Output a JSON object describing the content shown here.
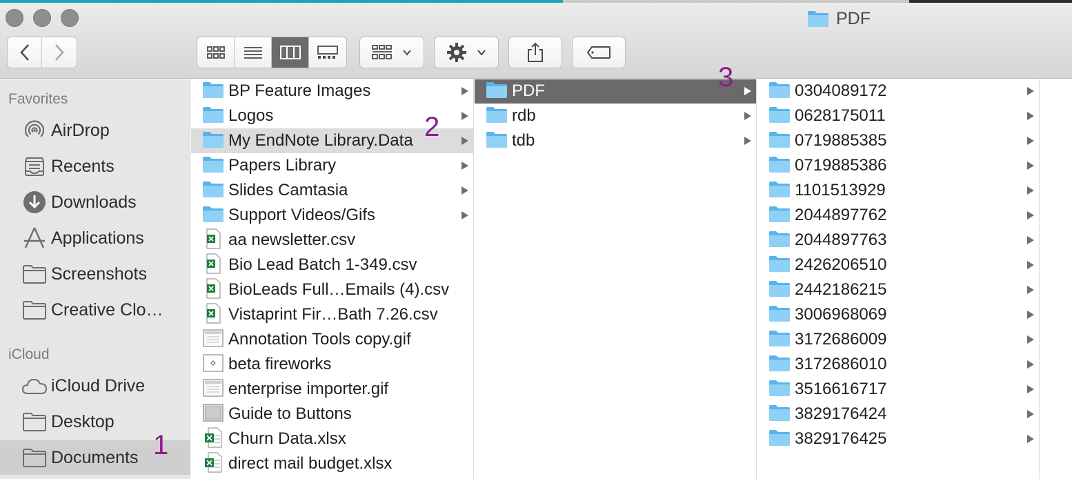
{
  "window": {
    "title": "PDF"
  },
  "toolbar": {
    "back_label": "Back",
    "forward_label": "Forward"
  },
  "sidebar": {
    "favorites_header": "Favorites",
    "icloud_header": "iCloud",
    "favorites": [
      {
        "label": "AirDrop",
        "icon": "airdrop-icon"
      },
      {
        "label": "Recents",
        "icon": "recents-icon"
      },
      {
        "label": "Downloads",
        "icon": "downloads-icon"
      },
      {
        "label": "Applications",
        "icon": "applications-icon"
      },
      {
        "label": "Screenshots",
        "icon": "folder-icon"
      },
      {
        "label": "Creative Clo…",
        "icon": "folder-icon"
      }
    ],
    "icloud": [
      {
        "label": "iCloud Drive",
        "icon": "cloud-icon"
      },
      {
        "label": "Desktop",
        "icon": "folder-icon"
      },
      {
        "label": "Documents",
        "icon": "folder-icon",
        "selected": true
      }
    ]
  },
  "annotations": {
    "one": "1",
    "two": "2",
    "three": "3"
  },
  "column1": [
    {
      "name": "BP Feature Images",
      "kind": "folder"
    },
    {
      "name": "Logos",
      "kind": "folder"
    },
    {
      "name": "My EndNote Library.Data",
      "kind": "folder",
      "selected": true
    },
    {
      "name": "Papers Library",
      "kind": "folder"
    },
    {
      "name": "Slides Camtasia",
      "kind": "folder"
    },
    {
      "name": "Support Videos/Gifs",
      "kind": "folder"
    },
    {
      "name": "aa newsletter.csv",
      "kind": "csv"
    },
    {
      "name": "Bio Lead Batch 1-349.csv",
      "kind": "csv"
    },
    {
      "name": "BioLeads Full…Emails (4).csv",
      "kind": "csv"
    },
    {
      "name": "Vistaprint Fir…Bath 7.26.csv",
      "kind": "csv"
    },
    {
      "name": "Annotation Tools copy.gif",
      "kind": "gif"
    },
    {
      "name": "beta fireworks",
      "kind": "doc"
    },
    {
      "name": "enterprise importer.gif",
      "kind": "gif"
    },
    {
      "name": "Guide to Buttons",
      "kind": "img"
    },
    {
      "name": "Churn Data.xlsx",
      "kind": "xlsx"
    },
    {
      "name": "direct mail budget.xlsx",
      "kind": "xlsx"
    }
  ],
  "column2": [
    {
      "name": "PDF",
      "kind": "folder",
      "selected": true
    },
    {
      "name": "rdb",
      "kind": "folder"
    },
    {
      "name": "tdb",
      "kind": "folder"
    }
  ],
  "column3": [
    {
      "name": "0304089172",
      "kind": "folder"
    },
    {
      "name": "0628175011",
      "kind": "folder"
    },
    {
      "name": "0719885385",
      "kind": "folder"
    },
    {
      "name": "0719885386",
      "kind": "folder"
    },
    {
      "name": "1101513929",
      "kind": "folder"
    },
    {
      "name": "2044897762",
      "kind": "folder"
    },
    {
      "name": "2044897763",
      "kind": "folder"
    },
    {
      "name": "2426206510",
      "kind": "folder"
    },
    {
      "name": "2442186215",
      "kind": "folder"
    },
    {
      "name": "3006968069",
      "kind": "folder"
    },
    {
      "name": "3172686009",
      "kind": "folder"
    },
    {
      "name": "3172686010",
      "kind": "folder"
    },
    {
      "name": "3516616717",
      "kind": "folder"
    },
    {
      "name": "3829176424",
      "kind": "folder"
    },
    {
      "name": "3829176425",
      "kind": "folder"
    }
  ],
  "colors": {
    "folder": "#7cc7f3",
    "folder_dark": "#5ab3ea",
    "selection_dark": "#6a6a6a",
    "annotation": "#8e1b8e"
  }
}
